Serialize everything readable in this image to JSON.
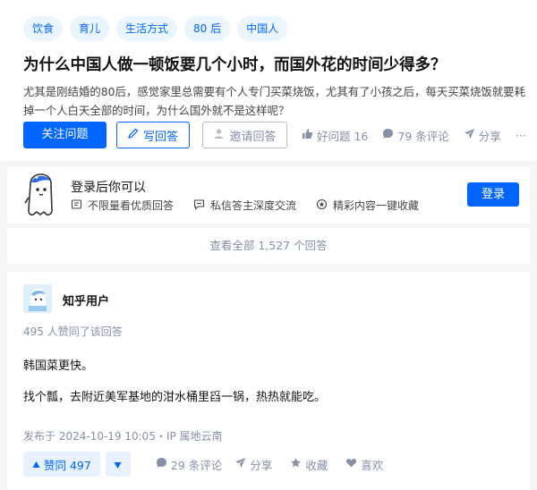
{
  "question": {
    "tags": [
      "饮食",
      "育儿",
      "生活方式",
      "80 后",
      "中国人"
    ],
    "title": "为什么中国人做一顿饭要几个小时，而国外花的时间少得多？",
    "detail": "尤其是刚结婚的80后，感觉家里总需要有个人专门买菜烧饭，尤其有了小孩之后，每天买菜烧饭就要耗掉一个人白天全部的时间，为什么国外就不是这样呢？",
    "actions": {
      "follow": "关注问题",
      "write_answer": "写回答",
      "invite": "邀请回答",
      "good_question": "好问题 16",
      "comments": "79 条评论",
      "share": "分享",
      "more": "···"
    }
  },
  "login_prompt": {
    "title": "登录后你可以",
    "features": [
      "不限量看优质回答",
      "私信答主深度交流",
      "精彩内容一键收藏"
    ],
    "login_button": "登录"
  },
  "view_all": "查看全部 1,527 个回答",
  "answer": {
    "author": "知乎用户",
    "vote_summary": "495 人赞同了该回答",
    "paragraphs": [
      "韩国菜更快。",
      "找个瓢，去附近美军基地的泔水桶里舀一锅，热热就能吃。"
    ],
    "published": "发布于 2024-10-19 10:05・IP 属地云南",
    "actions": {
      "upvote": "赞同 497",
      "comments": "29 条评论",
      "share": "分享",
      "collect": "收藏",
      "like": "喜欢"
    }
  },
  "colors": {
    "brand": "#0066ff",
    "tag_bg": "#ebf5ff",
    "muted": "#8590a6",
    "page_bg": "#f6f6f6"
  },
  "icons": [
    "pencil-icon",
    "invite-user-icon",
    "thumb-up-icon",
    "comment-icon",
    "share-icon",
    "more-icon",
    "mascot-icon",
    "card-icon",
    "message-icon",
    "collect-icon",
    "arrow-up-icon",
    "arrow-down-icon",
    "star-icon",
    "heart-icon",
    "avatar"
  ]
}
